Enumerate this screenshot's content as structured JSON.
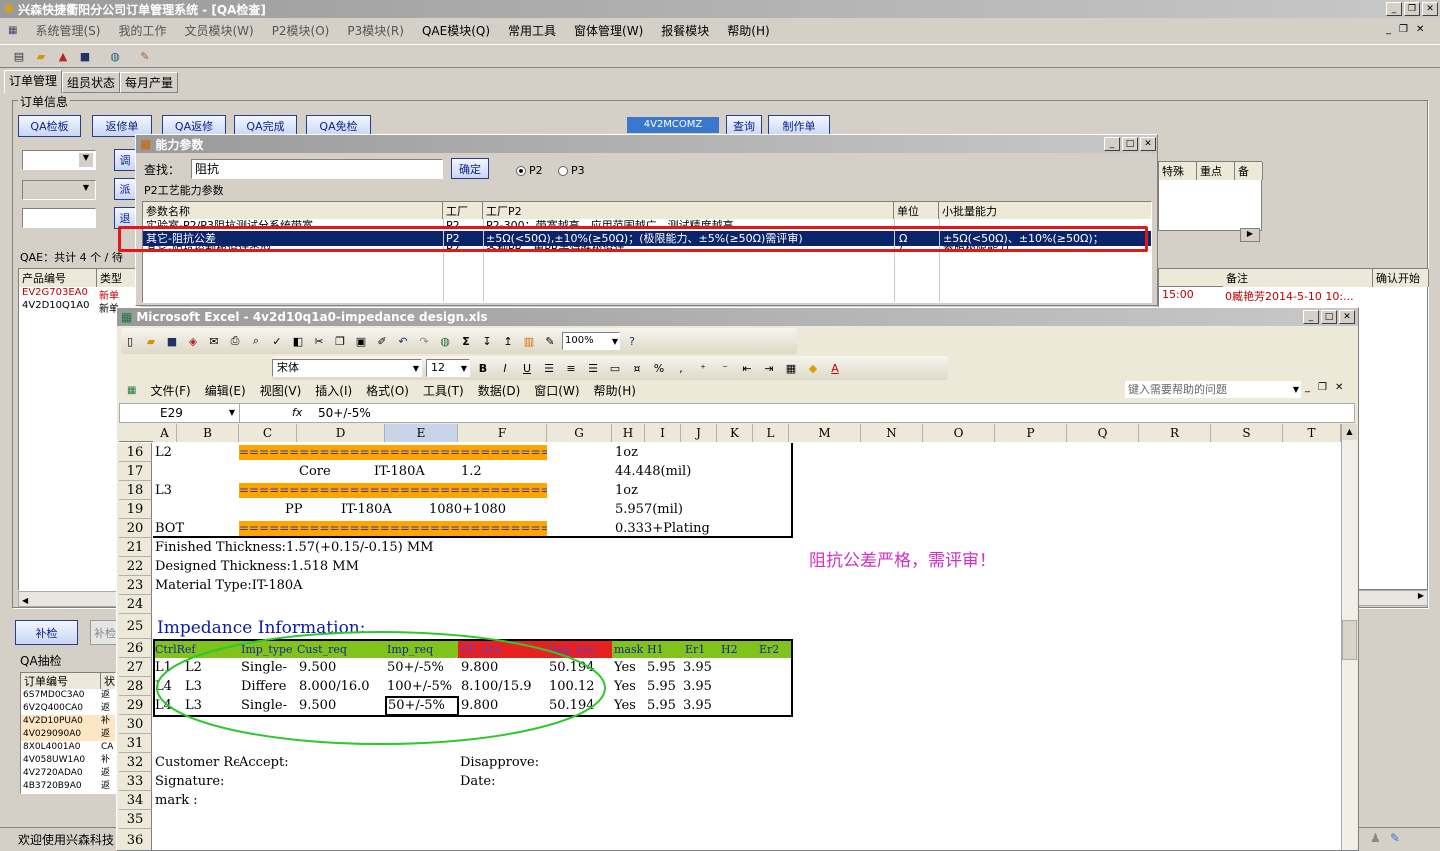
{
  "app": {
    "title": "兴森快捷衢阳分公司订单管理系统 - [QA检查]",
    "menus": [
      "系统管理(S)",
      "我的工作",
      "文员模块(W)",
      "P2模块(O)",
      "P3模块(R)",
      "QAE模块(Q)",
      "常用工具",
      "窗体管理(W)",
      "报餐模块",
      "帮助(H)"
    ],
    "tabs": [
      "订单管理",
      "组员状态",
      "每月产量"
    ],
    "status_text": "欢迎使用兴森科技"
  },
  "order_info": {
    "group_label": "订单信息",
    "buttons": [
      "QA检板",
      "返修单",
      "QA返修",
      "QA完成",
      "QA免检"
    ],
    "right_buttons": [
      "查询",
      "制作单"
    ],
    "order_code": "4V2MCOMZ",
    "side_buttons": [
      "调",
      "派",
      "退"
    ],
    "qae_count": "QAE：共计 4 个 / 待",
    "left_headers": [
      "产品编号",
      "类型"
    ],
    "left_rows": [
      {
        "code": "EV2G703EA0",
        "type": "新单",
        "red": true
      },
      {
        "code": "4V2D10Q1A0",
        "type": "新单",
        "red": false
      }
    ],
    "right_headers": [
      "特殊",
      "重点",
      "备"
    ],
    "mid_headers": [
      "备注",
      "确认开始"
    ],
    "mid_rows": [
      {
        "time": "15:00",
        "note": "0臧艳芳2014-5-10 10:..."
      }
    ],
    "bottom_buttons": [
      "补检",
      "补检"
    ],
    "qa_sample_label": "QA抽检",
    "sample_headers": [
      "订单编号",
      "状"
    ],
    "sample_rows": [
      {
        "code": "6S7MD0C3A0",
        "st": "返"
      },
      {
        "code": "6V2Q400CA0",
        "st": "返"
      },
      {
        "code": "4V2D10PUA0",
        "st": "补"
      },
      {
        "code": "4V029090A0",
        "st": "返"
      },
      {
        "code": "8X0L4001A0",
        "st": "CA"
      },
      {
        "code": "4V058UW1A0",
        "st": "补"
      },
      {
        "code": "4V2720ADA0",
        "st": "返"
      },
      {
        "code": "4B3720B9A0",
        "st": "返"
      }
    ]
  },
  "ability": {
    "title": "能力参数",
    "search_label": "查找：",
    "search_value": "阻抗",
    "confirm": "确定",
    "radio_p2": "P2",
    "radio_p3": "P3",
    "group_label": "P2工艺能力参数",
    "headers": [
      "参数名称",
      "工厂",
      "工厂P2",
      "单位",
      "小批量能力"
    ],
    "row_above": [
      "实验室-P2/P3阻抗测试分系统带宽",
      "P2",
      "P2-300：带宽越高，应用范围越广，测试精度越高",
      ""
    ],
    "selected": [
      "其它-阻抗公差",
      "P2",
      "±5Ω(<50Ω),±10%(≥50Ω)；(极限能力、±5%(≥50Ω)需评审)",
      "Ω",
      "±5Ω(<50Ω)、±10%(≥50Ω)；"
    ],
    "row_below": [
      "其它-阻抗控制板设计类型",
      "P2",
      "各种PR、单PR等特殊极设计",
      "/",
      "参照极限能力"
    ]
  },
  "excel": {
    "title": "Microsoft Excel - 4v2d10q1a0-impedance design.xls",
    "font": "宋体",
    "size": "12",
    "zoom": "100%",
    "menus": [
      "文件(F)",
      "编辑(E)",
      "视图(V)",
      "插入(I)",
      "格式(O)",
      "工具(T)",
      "数据(D)",
      "窗口(W)",
      "帮助(H)"
    ],
    "help_placeholder": "键入需要帮助的问题",
    "cell_ref": "E29",
    "fx": "fx",
    "formula": "50+/-5%",
    "cols": [
      "A",
      "B",
      "C",
      "D",
      "E",
      "F",
      "G",
      "H",
      "I",
      "J",
      "K",
      "L",
      "M",
      "N",
      "O",
      "P",
      "Q",
      "R",
      "S",
      "T"
    ],
    "rows": [
      "16",
      "17",
      "18",
      "19",
      "20",
      "21",
      "22",
      "23",
      "24",
      "25",
      "26",
      "27",
      "28",
      "29",
      "30",
      "31",
      "32",
      "33",
      "34",
      "35",
      "36"
    ],
    "r16a": "L2",
    "r16h": "1oz",
    "r17": [
      "Core",
      "IT-180A",
      "1.2"
    ],
    "r17h": "44.448(mil)",
    "r18a": "L3",
    "r18h": "1oz",
    "r19": [
      "PP",
      "IT-180A",
      "1080+1080"
    ],
    "r19h": "5.957(mil)",
    "r20a": "BOT",
    "r20h": "0.333+Plating",
    "eq": "==================================",
    "r21": "Finished Thickness:1.57(+0.15/-0.15) MM",
    "r22": "Designed Thickness:1.518 MM",
    "r23": "Material Type:IT-180A",
    "note": "阻抗公差严格，需评审！",
    "impedance_title": "Impedance Information:",
    "table_headers": [
      "CtrlRef",
      "Imp_type",
      "Cust_req",
      "Imp_req",
      "EP_des",
      "Imp_des",
      "mask",
      "H1",
      "Er1",
      "H2",
      "Er2"
    ],
    "table_rows": [
      [
        "L1",
        "L2",
        "Single-",
        "9.500",
        "50+/-5%",
        "9.800",
        "50.194",
        "Yes",
        "5.95",
        "3.95"
      ],
      [
        "L4",
        "L3",
        "Differe",
        "8.000/16.0",
        "100+/-5%",
        "8.100/15.9",
        "100.12",
        "Yes",
        "5.95",
        "3.95"
      ],
      [
        "L4",
        "L3",
        "Single-",
        "9.500",
        "50+/-5%",
        "9.800",
        "50.194",
        "Yes",
        "5.95",
        "3.95"
      ]
    ],
    "r32": [
      "Customer Re",
      "Accept:",
      "Disapprove:"
    ],
    "r33": [
      "Signature:",
      "Date:"
    ],
    "r34": "mark :"
  }
}
